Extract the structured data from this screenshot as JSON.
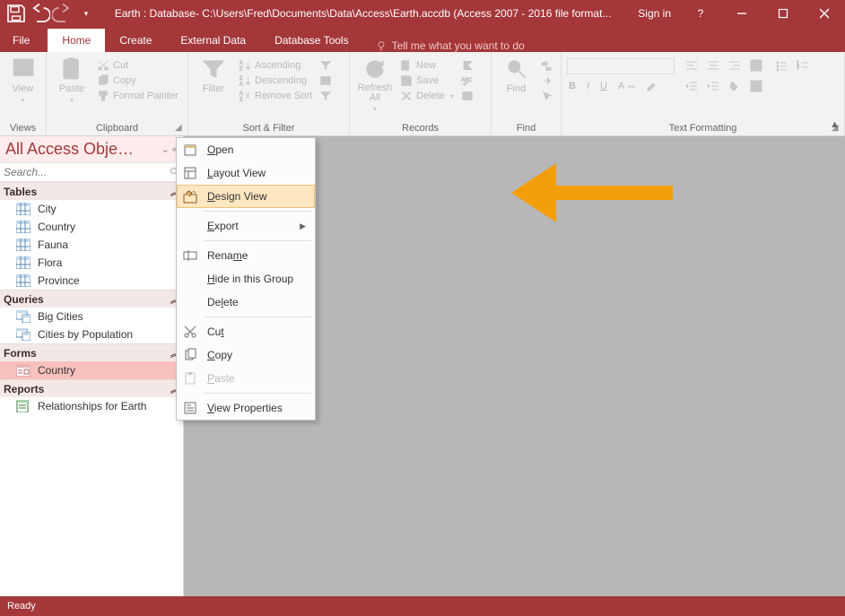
{
  "window": {
    "title": "Earth : Database- C:\\Users\\Fred\\Documents\\Data\\Access\\Earth.accdb (Access 2007 - 2016 file format...",
    "sign_in": "Sign in"
  },
  "tabs": {
    "file": "File",
    "home": "Home",
    "create": "Create",
    "external": "External Data",
    "dbtools": "Database Tools",
    "tellme": "Tell me what you want to do"
  },
  "ribbon": {
    "views": {
      "view": "View",
      "group": "Views"
    },
    "clipboard": {
      "paste": "Paste",
      "cut": "Cut",
      "copy": "Copy",
      "painter": "Format Painter",
      "group": "Clipboard"
    },
    "sortfilter": {
      "filter": "Filter",
      "asc": "Ascending",
      "desc": "Descending",
      "remove": "Remove Sort",
      "group": "Sort & Filter"
    },
    "records": {
      "refresh": "Refresh All",
      "new": "New",
      "save": "Save",
      "delete": "Delete",
      "group": "Records"
    },
    "find": {
      "find": "Find",
      "group": "Find"
    },
    "textfmt": {
      "group": "Text Formatting"
    }
  },
  "nav": {
    "title": "All Access Obje…",
    "search_placeholder": "Search...",
    "groups": {
      "tables": {
        "label": "Tables",
        "items": [
          "City",
          "Country",
          "Fauna",
          "Flora",
          "Province"
        ]
      },
      "queries": {
        "label": "Queries",
        "items": [
          "Big Cities",
          "Cities by Population"
        ]
      },
      "forms": {
        "label": "Forms",
        "items": [
          "Country"
        ]
      },
      "reports": {
        "label": "Reports",
        "items": [
          "Relationships for Earth"
        ]
      }
    }
  },
  "ctx": {
    "open": "pen",
    "layout": "ayout View",
    "design": "esign View",
    "export": "xport",
    "rename": "Rena",
    "rename2": "e",
    "hide": "ide in this Group",
    "delete": "De",
    "delete2": "ete",
    "cut": "Cu",
    "copy": "opy",
    "paste": "aste",
    "viewprops": "iew Properties"
  },
  "status": {
    "text": "Ready"
  }
}
